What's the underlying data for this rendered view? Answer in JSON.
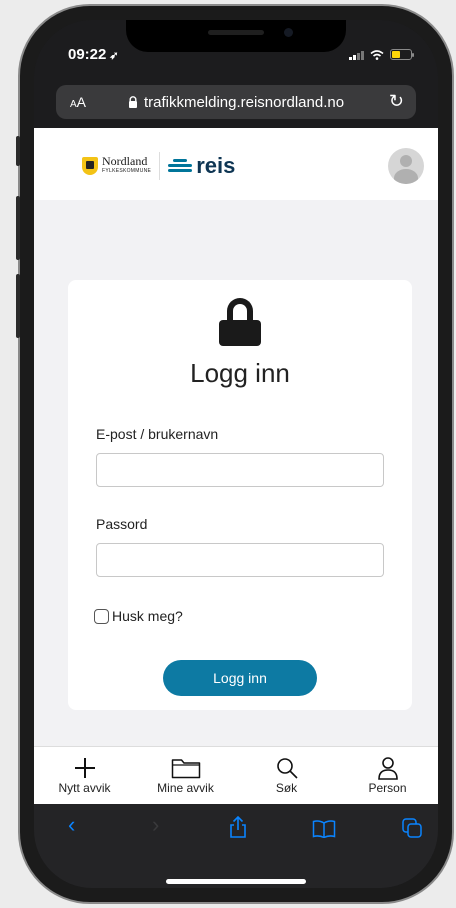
{
  "status": {
    "time": "09:22",
    "battery_level": 0.45
  },
  "browser": {
    "text_size_label": "AA",
    "url": "trafikkmelding.reisnordland.no"
  },
  "header": {
    "logo_nordland": "Nordland",
    "logo_nordland_sub": "FYLKESKOMMUNE",
    "logo_reis": "reis"
  },
  "login": {
    "title": "Logg inn",
    "username_label": "E-post / brukernavn",
    "username_value": "",
    "password_label": "Passord",
    "password_value": "",
    "remember_label": "Husk meg?",
    "remember_checked": false,
    "submit_label": "Logg inn"
  },
  "tabs": [
    {
      "label": "Nytt avvik",
      "icon": "plus-icon"
    },
    {
      "label": "Mine avvik",
      "icon": "folder-icon"
    },
    {
      "label": "Søk",
      "icon": "search-icon"
    },
    {
      "label": "Person",
      "icon": "person-icon"
    }
  ],
  "colors": {
    "accent": "#0d7aa3",
    "brand_dark": "#0e3553",
    "safari_blue": "#0a84ff",
    "battery": "#ffd60a"
  }
}
